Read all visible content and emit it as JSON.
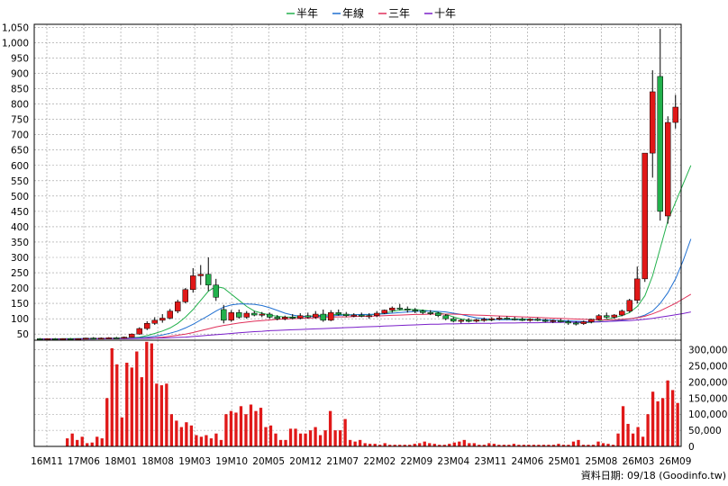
{
  "legend": [
    {
      "label": "半年",
      "color": "#22b14c"
    },
    {
      "label": "年線",
      "color": "#1f6fd1"
    },
    {
      "label": "三年",
      "color": "#e0305a"
    },
    {
      "label": "十年",
      "color": "#7a1fc9"
    }
  ],
  "source_text": "資料日期: 09/18  (Goodinfo.tw)",
  "chart_data": [
    {
      "type": "line",
      "subtype": "candlestick",
      "title": "",
      "xlabel": "",
      "ylabel": "",
      "ylim": [
        30,
        1060
      ],
      "yticks": [
        50,
        100,
        150,
        200,
        250,
        300,
        350,
        400,
        450,
        500,
        550,
        600,
        650,
        700,
        750,
        800,
        850,
        900,
        950,
        1000,
        1050
      ],
      "ytick_labels": [
        "50",
        "100",
        "150",
        "200",
        "250",
        "300",
        "350",
        "400",
        "450",
        "500",
        "550",
        "600",
        "650",
        "700",
        "750",
        "800",
        "850",
        "900",
        "950",
        "1,000",
        "1,050"
      ],
      "y_axis_side": "left",
      "grid": true,
      "legend_position": "top",
      "x_ticks": [
        "16M11",
        "17M06",
        "18M01",
        "18M08",
        "19M03",
        "19M10",
        "20M05",
        "20M12",
        "21M07",
        "22M02",
        "22M09",
        "23M04",
        "23M11",
        "24M06",
        "25M01",
        "25M08",
        "26M03",
        "26M09"
      ],
      "candles": [
        {
          "o": 35,
          "h": 37,
          "l": 33,
          "c": 34
        },
        {
          "o": 34,
          "h": 36,
          "l": 32,
          "c": 35
        },
        {
          "o": 35,
          "h": 37,
          "l": 33,
          "c": 34
        },
        {
          "o": 34,
          "h": 36,
          "l": 33,
          "c": 35
        },
        {
          "o": 35,
          "h": 37,
          "l": 33,
          "c": 34
        },
        {
          "o": 34,
          "h": 36,
          "l": 33,
          "c": 35
        },
        {
          "o": 35,
          "h": 38,
          "l": 34,
          "c": 37
        },
        {
          "o": 37,
          "h": 40,
          "l": 35,
          "c": 36
        },
        {
          "o": 36,
          "h": 39,
          "l": 34,
          "c": 37
        },
        {
          "o": 37,
          "h": 40,
          "l": 35,
          "c": 38
        },
        {
          "o": 38,
          "h": 41,
          "l": 36,
          "c": 37
        },
        {
          "o": 37,
          "h": 42,
          "l": 35,
          "c": 40
        },
        {
          "o": 40,
          "h": 52,
          "l": 39,
          "c": 50
        },
        {
          "o": 50,
          "h": 72,
          "l": 48,
          "c": 68
        },
        {
          "o": 68,
          "h": 92,
          "l": 63,
          "c": 85
        },
        {
          "o": 85,
          "h": 105,
          "l": 80,
          "c": 95
        },
        {
          "o": 95,
          "h": 115,
          "l": 87,
          "c": 102
        },
        {
          "o": 102,
          "h": 132,
          "l": 98,
          "c": 125
        },
        {
          "o": 125,
          "h": 162,
          "l": 118,
          "c": 155
        },
        {
          "o": 155,
          "h": 200,
          "l": 150,
          "c": 195
        },
        {
          "o": 195,
          "h": 265,
          "l": 185,
          "c": 240
        },
        {
          "o": 240,
          "h": 275,
          "l": 210,
          "c": 245
        },
        {
          "o": 245,
          "h": 300,
          "l": 190,
          "c": 210
        },
        {
          "o": 210,
          "h": 230,
          "l": 158,
          "c": 170
        },
        {
          "o": 130,
          "h": 145,
          "l": 85,
          "c": 95
        },
        {
          "o": 95,
          "h": 128,
          "l": 90,
          "c": 120
        },
        {
          "o": 120,
          "h": 130,
          "l": 100,
          "c": 105
        },
        {
          "o": 105,
          "h": 125,
          "l": 100,
          "c": 118
        },
        {
          "o": 118,
          "h": 125,
          "l": 108,
          "c": 112
        },
        {
          "o": 112,
          "h": 122,
          "l": 105,
          "c": 115
        },
        {
          "o": 115,
          "h": 120,
          "l": 100,
          "c": 105
        },
        {
          "o": 105,
          "h": 112,
          "l": 95,
          "c": 100
        },
        {
          "o": 100,
          "h": 110,
          "l": 95,
          "c": 105
        },
        {
          "o": 105,
          "h": 115,
          "l": 98,
          "c": 102
        },
        {
          "o": 102,
          "h": 118,
          "l": 98,
          "c": 110
        },
        {
          "o": 110,
          "h": 120,
          "l": 100,
          "c": 105
        },
        {
          "o": 105,
          "h": 125,
          "l": 100,
          "c": 115
        },
        {
          "o": 115,
          "h": 130,
          "l": 90,
          "c": 95
        },
        {
          "o": 95,
          "h": 128,
          "l": 92,
          "c": 120
        },
        {
          "o": 120,
          "h": 130,
          "l": 110,
          "c": 115
        },
        {
          "o": 115,
          "h": 122,
          "l": 105,
          "c": 110
        },
        {
          "o": 110,
          "h": 118,
          "l": 105,
          "c": 112
        },
        {
          "o": 112,
          "h": 120,
          "l": 105,
          "c": 108
        },
        {
          "o": 108,
          "h": 118,
          "l": 100,
          "c": 110
        },
        {
          "o": 110,
          "h": 125,
          "l": 105,
          "c": 118
        },
        {
          "o": 118,
          "h": 130,
          "l": 115,
          "c": 128
        },
        {
          "o": 128,
          "h": 140,
          "l": 120,
          "c": 135
        },
        {
          "o": 135,
          "h": 148,
          "l": 128,
          "c": 132
        },
        {
          "o": 132,
          "h": 140,
          "l": 120,
          "c": 128
        },
        {
          "o": 128,
          "h": 135,
          "l": 118,
          "c": 125
        },
        {
          "o": 125,
          "h": 130,
          "l": 115,
          "c": 120
        },
        {
          "o": 120,
          "h": 128,
          "l": 112,
          "c": 118
        },
        {
          "o": 118,
          "h": 122,
          "l": 105,
          "c": 110
        },
        {
          "o": 110,
          "h": 115,
          "l": 95,
          "c": 100
        },
        {
          "o": 100,
          "h": 105,
          "l": 88,
          "c": 92
        },
        {
          "o": 92,
          "h": 100,
          "l": 85,
          "c": 95
        },
        {
          "o": 95,
          "h": 102,
          "l": 88,
          "c": 92
        },
        {
          "o": 92,
          "h": 100,
          "l": 88,
          "c": 96
        },
        {
          "o": 96,
          "h": 104,
          "l": 90,
          "c": 98
        },
        {
          "o": 98,
          "h": 105,
          "l": 92,
          "c": 100
        },
        {
          "o": 100,
          "h": 108,
          "l": 95,
          "c": 102
        },
        {
          "o": 102,
          "h": 108,
          "l": 96,
          "c": 100
        },
        {
          "o": 100,
          "h": 106,
          "l": 94,
          "c": 98
        },
        {
          "o": 98,
          "h": 104,
          "l": 92,
          "c": 96
        },
        {
          "o": 96,
          "h": 102,
          "l": 90,
          "c": 98
        },
        {
          "o": 98,
          "h": 104,
          "l": 92,
          "c": 95
        },
        {
          "o": 95,
          "h": 100,
          "l": 88,
          "c": 92
        },
        {
          "o": 92,
          "h": 98,
          "l": 86,
          "c": 94
        },
        {
          "o": 94,
          "h": 100,
          "l": 88,
          "c": 90
        },
        {
          "o": 90,
          "h": 96,
          "l": 80,
          "c": 86
        },
        {
          "o": 86,
          "h": 92,
          "l": 78,
          "c": 84
        },
        {
          "o": 84,
          "h": 94,
          "l": 80,
          "c": 90
        },
        {
          "o": 90,
          "h": 100,
          "l": 85,
          "c": 98
        },
        {
          "o": 98,
          "h": 115,
          "l": 95,
          "c": 110
        },
        {
          "o": 110,
          "h": 120,
          "l": 100,
          "c": 105
        },
        {
          "o": 105,
          "h": 115,
          "l": 100,
          "c": 112
        },
        {
          "o": 112,
          "h": 130,
          "l": 108,
          "c": 125
        },
        {
          "o": 125,
          "h": 165,
          "l": 120,
          "c": 160
        },
        {
          "o": 160,
          "h": 270,
          "l": 150,
          "c": 230
        },
        {
          "o": 230,
          "h": 600,
          "l": 220,
          "c": 640
        },
        {
          "o": 640,
          "h": 910,
          "l": 560,
          "c": 840
        },
        {
          "o": 890,
          "h": 1045,
          "l": 420,
          "c": 450
        },
        {
          "o": 435,
          "h": 760,
          "l": 410,
          "c": 740
        },
        {
          "o": 740,
          "h": 830,
          "l": 720,
          "c": 790
        }
      ],
      "series": [
        {
          "name": "半年",
          "color": "#22b14c",
          "values": [
            34,
            34,
            34,
            35,
            35,
            35,
            35,
            36,
            36,
            36,
            37,
            37,
            38,
            40,
            45,
            52,
            60,
            70,
            85,
            105,
            130,
            160,
            190,
            205,
            200,
            180,
            160,
            140,
            125,
            118,
            112,
            108,
            105,
            105,
            106,
            108,
            110,
            112,
            113,
            114,
            113,
            113,
            113,
            113,
            114,
            118,
            124,
            128,
            130,
            130,
            128,
            125,
            120,
            114,
            106,
            99,
            95,
            94,
            95,
            96,
            98,
            99,
            99,
            99,
            98,
            97,
            96,
            95,
            93,
            90,
            88,
            87,
            88,
            92,
            98,
            104,
            110,
            120,
            140,
            175,
            240,
            330,
            420,
            480,
            540,
            600
          ]
        },
        {
          "name": "年線",
          "color": "#1f6fd1",
          "values": [
            34,
            34,
            34,
            34,
            34,
            35,
            35,
            35,
            35,
            35,
            36,
            36,
            37,
            38,
            40,
            43,
            47,
            53,
            60,
            70,
            82,
            96,
            110,
            125,
            138,
            145,
            148,
            148,
            147,
            143,
            136,
            127,
            118,
            112,
            108,
            107,
            107,
            108,
            109,
            111,
            112,
            113,
            114,
            114,
            115,
            116,
            118,
            120,
            122,
            124,
            125,
            125,
            124,
            122,
            118,
            114,
            108,
            103,
            100,
            98,
            97,
            97,
            97,
            97,
            97,
            96,
            96,
            95,
            94,
            93,
            92,
            91,
            90,
            90,
            91,
            93,
            96,
            99,
            104,
            112,
            125,
            150,
            185,
            230,
            290,
            360
          ]
        },
        {
          "name": "三年",
          "color": "#e0305a",
          "values": [
            34,
            34,
            34,
            34,
            34,
            34,
            34,
            35,
            35,
            35,
            35,
            35,
            36,
            36,
            37,
            38,
            40,
            43,
            46,
            50,
            55,
            61,
            67,
            73,
            78,
            82,
            86,
            89,
            92,
            94,
            96,
            98,
            99,
            100,
            101,
            102,
            103,
            104,
            105,
            106,
            106,
            107,
            108,
            108,
            109,
            110,
            111,
            112,
            113,
            114,
            114,
            115,
            115,
            115,
            115,
            114,
            113,
            112,
            111,
            110,
            109,
            108,
            107,
            106,
            105,
            104,
            103,
            102,
            101,
            100,
            99,
            98,
            97,
            96,
            96,
            97,
            98,
            100,
            103,
            108,
            116,
            126,
            138,
            150,
            165,
            180
          ]
        },
        {
          "name": "十年",
          "color": "#7a1fc9",
          "values": [
            34,
            34,
            34,
            34,
            34,
            34,
            34,
            34,
            35,
            35,
            35,
            35,
            35,
            36,
            36,
            37,
            37,
            38,
            39,
            40,
            42,
            44,
            46,
            48,
            50,
            52,
            54,
            56,
            58,
            59,
            61,
            62,
            63,
            64,
            65,
            66,
            67,
            68,
            69,
            70,
            71,
            72,
            73,
            74,
            75,
            76,
            77,
            78,
            79,
            80,
            81,
            82,
            82,
            83,
            83,
            84,
            84,
            85,
            85,
            85,
            86,
            86,
            86,
            87,
            87,
            87,
            88,
            88,
            88,
            89,
            89,
            89,
            90,
            90,
            91,
            92,
            93,
            94,
            96,
            98,
            101,
            105,
            109,
            113,
            117,
            122
          ]
        }
      ]
    },
    {
      "type": "bar",
      "title": "",
      "xlabel": "",
      "ylabel": "",
      "ylim": [
        0,
        330000
      ],
      "yticks": [
        0,
        50000,
        100000,
        150000,
        200000,
        250000,
        300000
      ],
      "ytick_labels": [
        "0",
        "50,000",
        "100,000",
        "150,000",
        "200,000",
        "250,000",
        "300,000"
      ],
      "y_axis_side": "right",
      "grid": true,
      "color": "#e01818",
      "values": [
        0,
        0,
        0,
        0,
        0,
        0,
        25000,
        40000,
        20000,
        30000,
        10000,
        12000,
        30000,
        25000,
        150000,
        305000,
        255000,
        90000,
        260000,
        245000,
        295000,
        215000,
        325000,
        320000,
        195000,
        190000,
        195000,
        100000,
        80000,
        60000,
        75000,
        65000,
        35000,
        30000,
        35000,
        25000,
        40000,
        20000,
        100000,
        110000,
        105000,
        125000,
        100000,
        130000,
        110000,
        120000,
        60000,
        65000,
        40000,
        20000,
        20000,
        55000,
        55000,
        40000,
        40000,
        50000,
        60000,
        35000,
        50000,
        110000,
        50000,
        50000,
        85000,
        20000,
        15000,
        20000,
        10000,
        8000,
        8000,
        5000,
        10000,
        5000,
        5000,
        5000,
        5000,
        5000,
        8000,
        10000,
        15000,
        10000,
        8000,
        5000,
        5000,
        8000,
        12000,
        15000,
        20000,
        10000,
        10000,
        5000,
        5000,
        10000,
        8000,
        5000,
        5000,
        5000,
        8000,
        5000,
        5000,
        5000,
        5000,
        5000,
        5000,
        5000,
        5000,
        8000,
        5000,
        5000,
        15000,
        20000,
        5000,
        5000,
        5000,
        15000,
        10000,
        8000,
        5000,
        40000,
        125000,
        70000,
        40000,
        60000,
        30000,
        100000,
        170000,
        140000,
        150000,
        205000,
        175000,
        135000
      ]
    }
  ]
}
